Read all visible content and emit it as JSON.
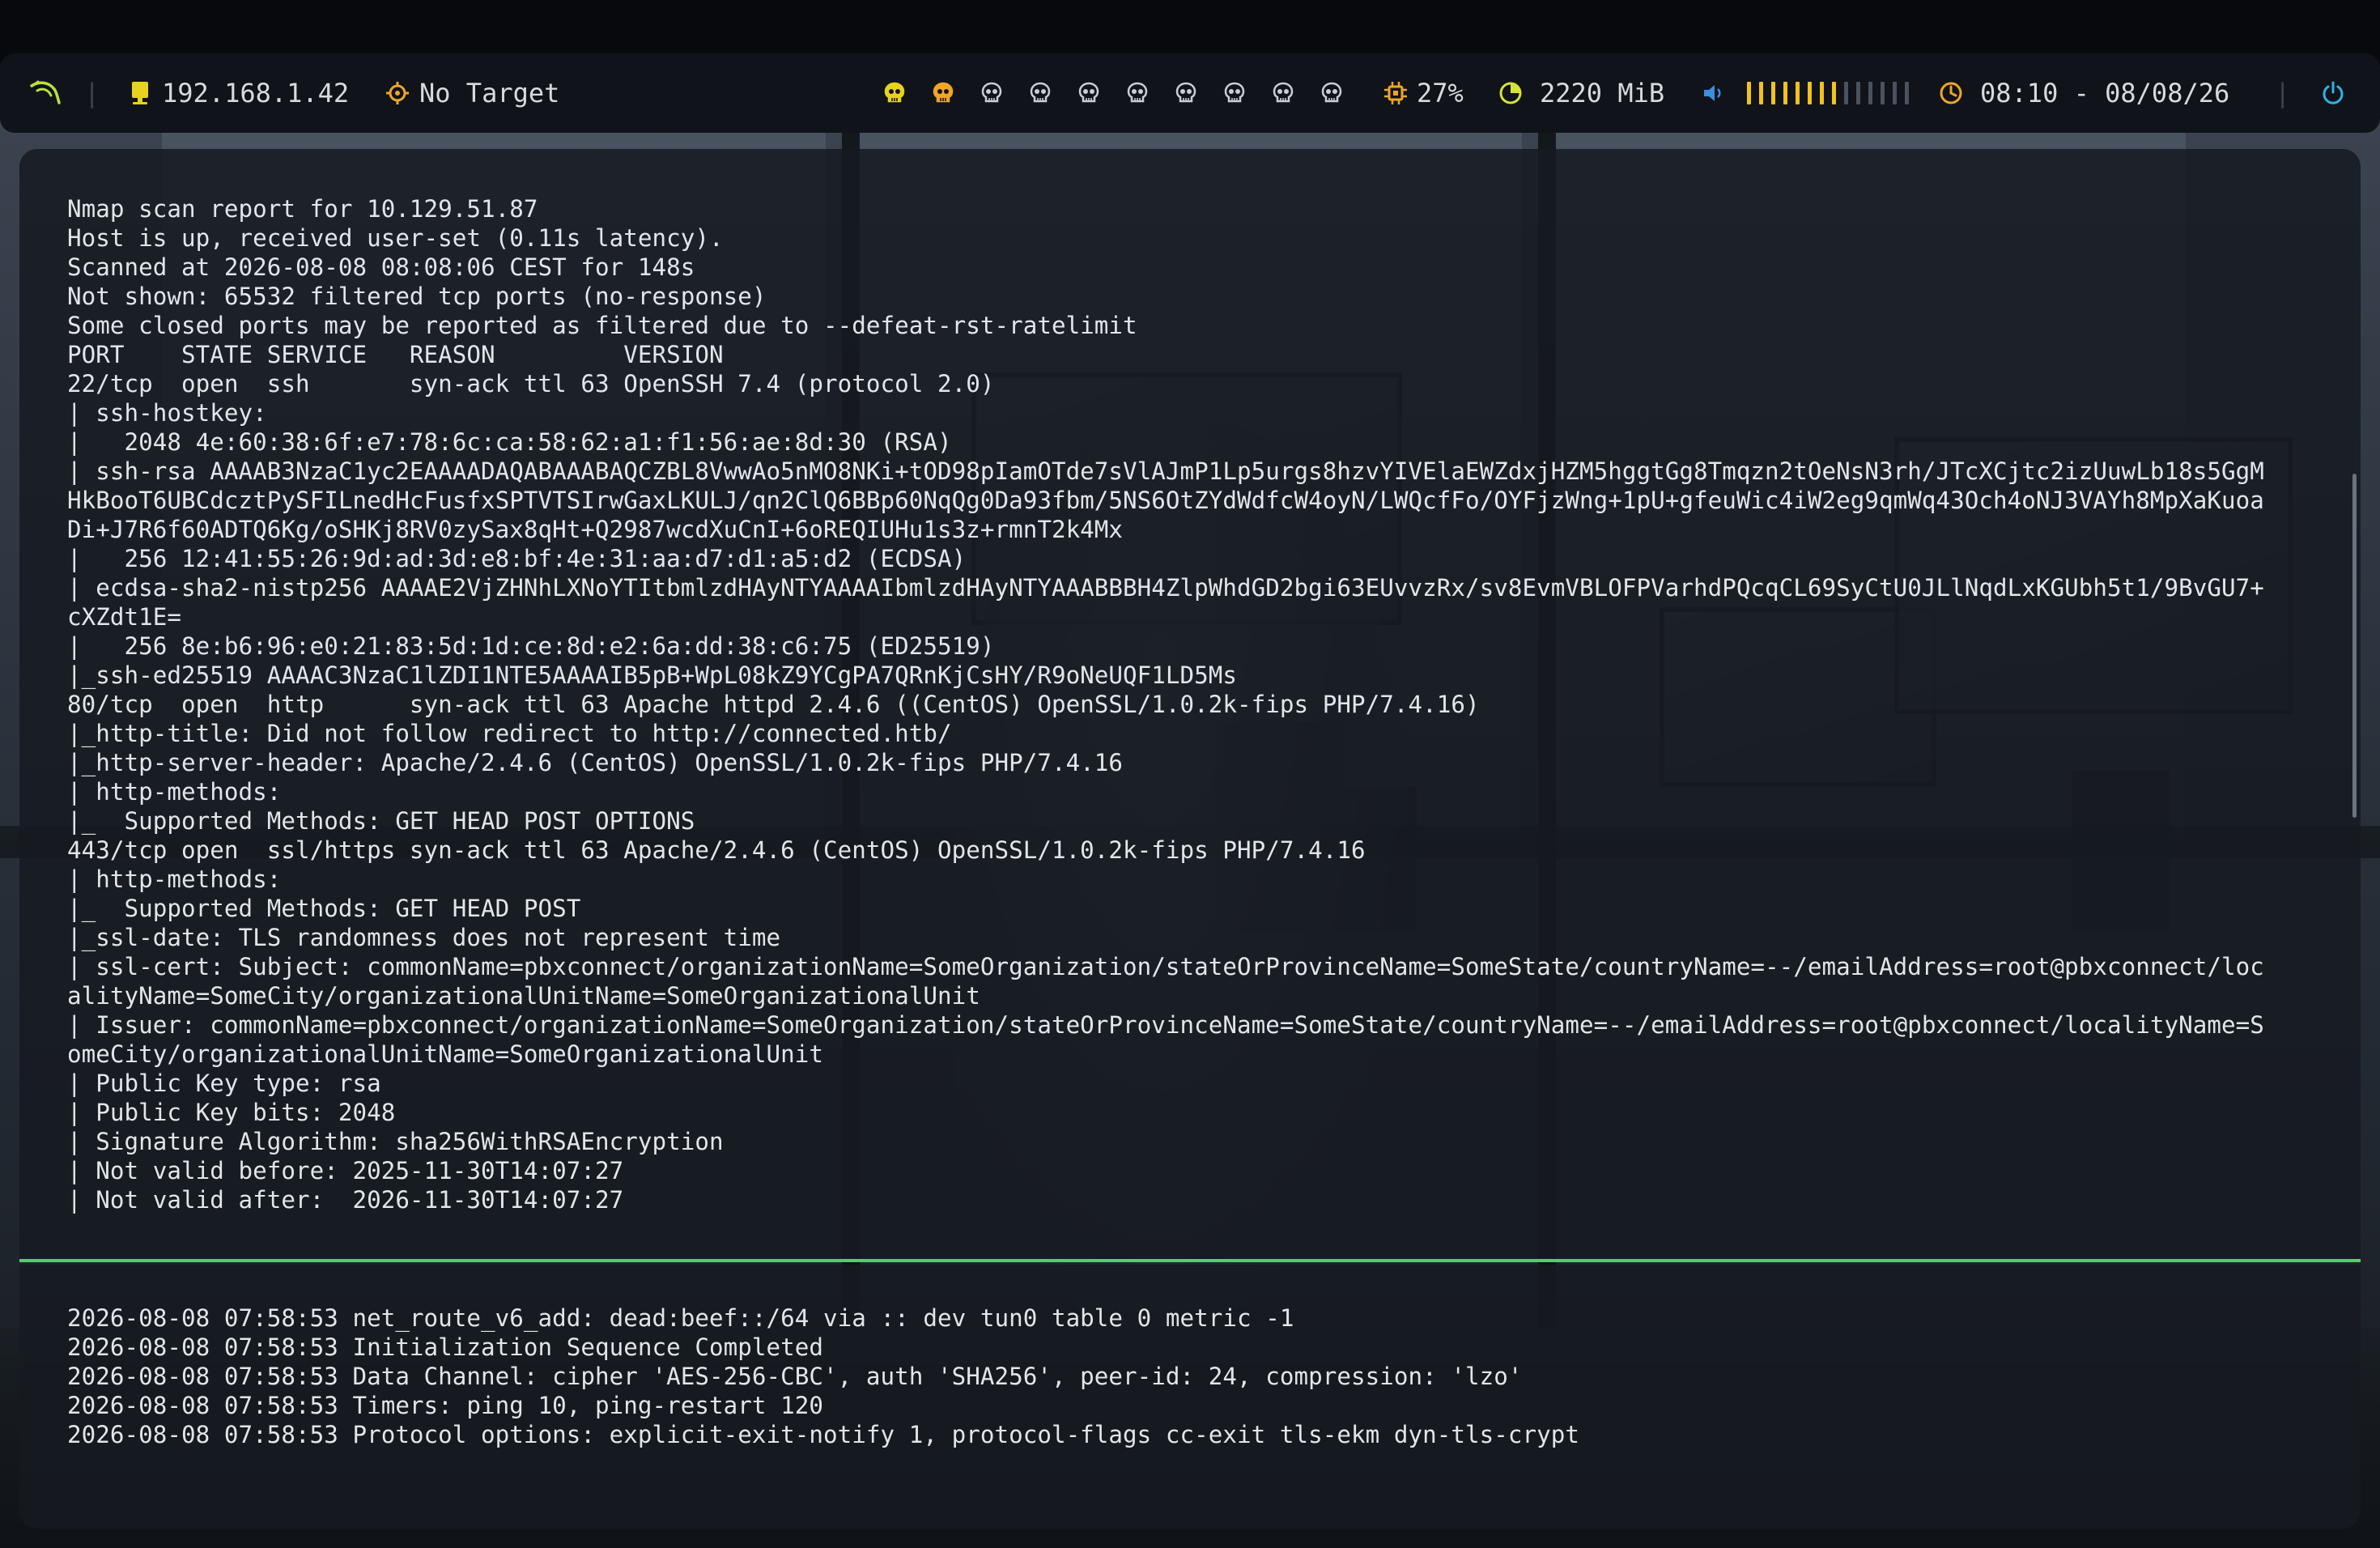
{
  "topbar": {
    "ip": "192.168.1.42",
    "target": "No Target",
    "workspaces": [
      {
        "icon": "skull-icon",
        "color": "#e6d21f",
        "active": true
      },
      {
        "icon": "skull-icon",
        "color": "#f0a526",
        "active": true
      },
      {
        "icon": "skull-icon",
        "color": "#c9ced6",
        "active": false
      },
      {
        "icon": "skull-icon",
        "color": "#c9ced6",
        "active": false
      },
      {
        "icon": "skull-icon",
        "color": "#c9ced6",
        "active": false
      },
      {
        "icon": "skull-icon",
        "color": "#c9ced6",
        "active": false
      },
      {
        "icon": "skull-icon",
        "color": "#c9ced6",
        "active": false
      },
      {
        "icon": "skull-icon",
        "color": "#c9ced6",
        "active": false
      },
      {
        "icon": "skull-icon",
        "color": "#c9ced6",
        "active": false
      },
      {
        "icon": "skull-icon",
        "color": "#c9ced6",
        "active": false
      }
    ],
    "cpu": "27%",
    "memory": "2220 MiB",
    "volume_level": 0.6,
    "volume_segments": 14,
    "clock": "08:10 - 08/08/26",
    "colors": {
      "accent_green": "#b9e23b",
      "yellow": "#f1c21b",
      "orange": "#f0a526",
      "ip_icon": "#e8d21f",
      "target_icon": "#f0a526",
      "cpu_icon": "#f0a526",
      "mem_icon": "#d6e23a",
      "volume_icon": "#3b8fe0",
      "clock_icon": "#f0a526",
      "power_icon": "#2fb3e6"
    }
  },
  "terminal_top": {
    "lines": [
      "Nmap scan report for 10.129.51.87",
      "Host is up, received user-set (0.11s latency).",
      "Scanned at 2026-08-08 08:08:06 CEST for 148s",
      "Not shown: 65532 filtered tcp ports (no-response)",
      "Some closed ports may be reported as filtered due to --defeat-rst-ratelimit",
      "PORT    STATE SERVICE   REASON         VERSION",
      "22/tcp  open  ssh       syn-ack ttl 63 OpenSSH 7.4 (protocol 2.0)",
      "| ssh-hostkey: ",
      "|   2048 4e:60:38:6f:e7:78:6c:ca:58:62:a1:f1:56:ae:8d:30 (RSA)",
      "| ssh-rsa AAAAB3NzaC1yc2EAAAADAQABAAABAQCZBL8VwwAo5nMO8NKi+tOD98pIamOTde7sVlAJmP1Lp5urgs8hzvYIVElaEWZdxjHZM5hggtGg8Tmqzn2tOeNsN3rh/JTcXCjtc2izUuwLb18s5GgM",
      "HkBooT6UBCdcztPySFILnedHcFusfxSPTVTSIrwGaxLKULJ/qn2ClQ6BBp60NqQg0Da93fbm/5NS6OtZYdWdfcW4oyN/LWQcfFo/OYFjzWng+1pU+gfeuWic4iW2eg9qmWq43Och4oNJ3VAYh8MpXaKuoa",
      "Di+J7R6f60ADTQ6Kg/oSHKj8RV0zySax8qHt+Q2987wcdXuCnI+6oREQIUHu1s3z+rmnT2k4Mx",
      "|   256 12:41:55:26:9d:ad:3d:e8:bf:4e:31:aa:d7:d1:a5:d2 (ECDSA)",
      "| ecdsa-sha2-nistp256 AAAAE2VjZHNhLXNoYTItbmlzdHAyNTYAAAAIbmlzdHAyNTYAAABBBH4ZlpWhdGD2bgi63EUvvzRx/sv8EvmVBLOFPVarhdPQcqCL69SyCtU0JLlNqdLxKGUbh5t1/9BvGU7+",
      "cXZdt1E=",
      "|   256 8e:b6:96:e0:21:83:5d:1d:ce:8d:e2:6a:dd:38:c6:75 (ED25519)",
      "|_ssh-ed25519 AAAAC3NzaC1lZDI1NTE5AAAAIB5pB+WpL08kZ9YCgPA7QRnKjCsHY/R9oNeUQF1LD5Ms",
      "80/tcp  open  http      syn-ack ttl 63 Apache httpd 2.4.6 ((CentOS) OpenSSL/1.0.2k-fips PHP/7.4.16)",
      "|_http-title: Did not follow redirect to http://connected.htb/",
      "|_http-server-header: Apache/2.4.6 (CentOS) OpenSSL/1.0.2k-fips PHP/7.4.16",
      "| http-methods: ",
      "|_  Supported Methods: GET HEAD POST OPTIONS",
      "443/tcp open  ssl/https syn-ack ttl 63 Apache/2.4.6 (CentOS) OpenSSL/1.0.2k-fips PHP/7.4.16",
      "| http-methods: ",
      "|_  Supported Methods: GET HEAD POST",
      "|_ssl-date: TLS randomness does not represent time",
      "| ssl-cert: Subject: commonName=pbxconnect/organizationName=SomeOrganization/stateOrProvinceName=SomeState/countryName=--/emailAddress=root@pbxconnect/loc",
      "alityName=SomeCity/organizationalUnitName=SomeOrganizationalUnit",
      "| Issuer: commonName=pbxconnect/organizationName=SomeOrganization/stateOrProvinceName=SomeState/countryName=--/emailAddress=root@pbxconnect/localityName=S",
      "omeCity/organizationalUnitName=SomeOrganizationalUnit",
      "| Public Key type: rsa",
      "| Public Key bits: 2048",
      "| Signature Algorithm: sha256WithRSAEncryption",
      "| Not valid before: 2025-11-30T14:07:27",
      "| Not valid after:  2026-11-30T14:07:27"
    ]
  },
  "terminal_bottom": {
    "lines": [
      "2026-08-08 07:58:53 net_route_v6_add: dead:beef::/64 via :: dev tun0 table 0 metric -1",
      "2026-08-08 07:58:53 Initialization Sequence Completed",
      "2026-08-08 07:58:53 Data Channel: cipher 'AES-256-CBC', auth 'SHA256', peer-id: 24, compression: 'lzo'",
      "2026-08-08 07:58:53 Timers: ping 10, ping-restart 120",
      "2026-08-08 07:58:53 Protocol options: explicit-exit-notify 1, protocol-flags cc-exit tls-ekm dyn-tls-crypt"
    ]
  }
}
